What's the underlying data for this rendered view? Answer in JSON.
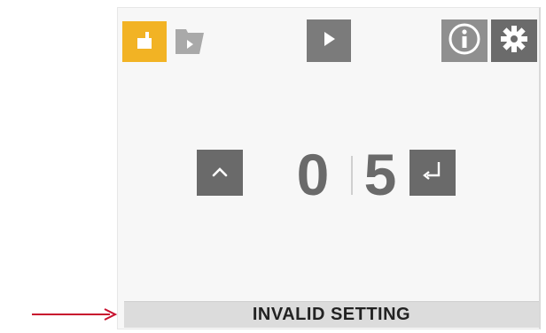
{
  "toolbar": {
    "items": [
      {
        "name": "document-tab",
        "icon": "document-icon",
        "active": true
      },
      {
        "name": "folder-tab",
        "icon": "folder-play-icon",
        "active": false
      },
      {
        "name": "play",
        "icon": "play-icon"
      },
      {
        "name": "info",
        "icon": "info-icon"
      },
      {
        "name": "settings",
        "icon": "gear-icon"
      }
    ]
  },
  "counter": {
    "digits": [
      "0",
      "5"
    ],
    "increment_icon": "chevron-up-icon",
    "enter_icon": "enter-icon"
  },
  "status": {
    "message": "INVALID SETTING"
  },
  "annotation": {
    "icon": "pointer-arrow-icon",
    "color": "#c8102e"
  },
  "colors": {
    "accent": "#f2b324",
    "button_dark": "#6a6a6a",
    "status_bg": "#dcdcdc"
  }
}
